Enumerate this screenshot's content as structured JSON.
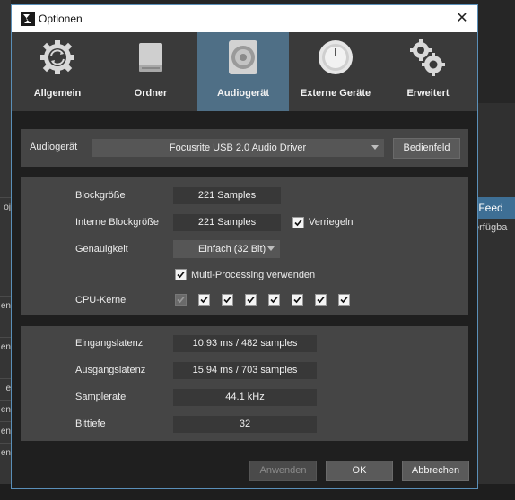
{
  "window": {
    "title": "Optionen",
    "close_glyph": "✕"
  },
  "tabs": [
    {
      "label": "Allgemein",
      "icon": "gear-refresh-icon",
      "active": false
    },
    {
      "label": "Ordner",
      "icon": "drive-icon",
      "active": false
    },
    {
      "label": "Audiogerät",
      "icon": "speaker-icon",
      "active": true
    },
    {
      "label": "Externe Geräte",
      "icon": "knob-icon",
      "active": false
    },
    {
      "label": "Erweitert",
      "icon": "gears-icon",
      "active": false
    }
  ],
  "device": {
    "label": "Audiogerät",
    "selected": "Focusrite USB 2.0 Audio Driver",
    "panel_button": "Bedienfeld"
  },
  "settings": {
    "blocksize_label": "Blockgröße",
    "blocksize_value": "221 Samples",
    "internal_blocksize_label": "Interne Blockgröße",
    "internal_blocksize_value": "221 Samples",
    "lock_label": "Verriegeln",
    "precision_label": "Genauigkeit",
    "precision_value": "Einfach (32 Bit)",
    "multiprocessing_label": "Multi-Processing verwenden",
    "cpu_cores_label": "CPU-Kerne",
    "cpu_cores": [
      {
        "checked": true,
        "disabled": true
      },
      {
        "checked": true,
        "disabled": false
      },
      {
        "checked": true,
        "disabled": false
      },
      {
        "checked": true,
        "disabled": false
      },
      {
        "checked": true,
        "disabled": false
      },
      {
        "checked": true,
        "disabled": false
      },
      {
        "checked": true,
        "disabled": false
      },
      {
        "checked": true,
        "disabled": false
      }
    ]
  },
  "info": {
    "input_latency_label": "Eingangslatenz",
    "input_latency_value": "10.93 ms / 482 samples",
    "output_latency_label": "Ausgangslatenz",
    "output_latency_value": "15.94 ms / 703 samples",
    "samplerate_label": "Samplerate",
    "samplerate_value": "44.1 kHz",
    "bitdepth_label": "Bittiefe",
    "bitdepth_value": "32"
  },
  "footer": {
    "apply": "Anwenden",
    "ok": "OK",
    "cancel": "Abbrechen"
  },
  "background": {
    "left_rows": [
      "en",
      "en",
      "e",
      "en",
      "en",
      "en"
    ],
    "left_top_text": "oj",
    "right_highlight": "s Feed",
    "right_text": "erfügba"
  },
  "colors": {
    "accent": "#4f6f86",
    "border": "#5a8fb8"
  }
}
